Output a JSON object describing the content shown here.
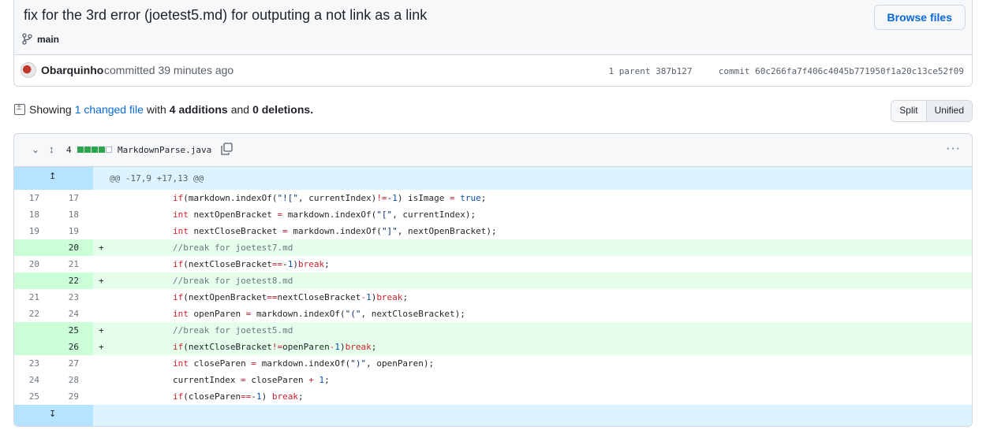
{
  "commit": {
    "title": "fix for the 3rd error (joetest5.md) for outputing a not link as a link",
    "browse_label": "Browse files",
    "branch": "main",
    "author": "Obarquinho",
    "committed_text": "committed 39 minutes ago",
    "parent_label": "1 parent",
    "parent_sha": "387b127",
    "commit_label": "commit",
    "commit_sha": "60c266fa7f406c4045b771950f1a20c13ce52f09"
  },
  "summary": {
    "showing": "Showing",
    "changed_link": "1 changed file",
    "with": "with",
    "additions": "4 additions",
    "and": "and",
    "deletions": "0 deletions.",
    "split_label": "Split",
    "unified_label": "Unified"
  },
  "file": {
    "change_count": "4",
    "name": "MarkdownParse.java",
    "diffstat": [
      "add",
      "add",
      "add",
      "add",
      "neutral"
    ]
  },
  "hunk": "@@ -17,9 +17,13 @@",
  "lines": [
    {
      "old": "17",
      "new": "17",
      "type": "ctx",
      "sign": "",
      "code": [
        [
          "kw",
          "if"
        ],
        [
          "t",
          "(markdown.indexOf("
        ],
        [
          "str",
          "\"![\""
        ],
        [
          "t",
          ", currentIndex)"
        ],
        [
          "kw",
          "!="
        ],
        [
          "t",
          "-"
        ],
        [
          "num",
          "1"
        ],
        [
          "t",
          ") isImage "
        ],
        [
          "kw",
          "="
        ],
        [
          "t",
          " "
        ],
        [
          "num",
          "true"
        ],
        [
          "t",
          ";"
        ]
      ]
    },
    {
      "old": "18",
      "new": "18",
      "type": "ctx",
      "sign": "",
      "code": [
        [
          "kw",
          "int"
        ],
        [
          "t",
          " nextOpenBracket "
        ],
        [
          "kw",
          "="
        ],
        [
          "t",
          " markdown.indexOf("
        ],
        [
          "str",
          "\"[\""
        ],
        [
          "t",
          ", currentIndex);"
        ]
      ]
    },
    {
      "old": "19",
      "new": "19",
      "type": "ctx",
      "sign": "",
      "code": [
        [
          "kw",
          "int"
        ],
        [
          "t",
          " nextCloseBracket "
        ],
        [
          "kw",
          "="
        ],
        [
          "t",
          " markdown.indexOf("
        ],
        [
          "str",
          "\"]\""
        ],
        [
          "t",
          ", nextOpenBracket);"
        ]
      ]
    },
    {
      "old": "",
      "new": "20",
      "type": "add",
      "sign": "+",
      "code": [
        [
          "cm",
          "//break for joetest7.md"
        ]
      ]
    },
    {
      "old": "20",
      "new": "21",
      "type": "ctx",
      "sign": "",
      "code": [
        [
          "kw",
          "if"
        ],
        [
          "t",
          "(nextCloseBracket"
        ],
        [
          "kw",
          "=="
        ],
        [
          "t",
          "-"
        ],
        [
          "num",
          "1"
        ],
        [
          "t",
          ")"
        ],
        [
          "kw",
          "break"
        ],
        [
          "t",
          ";"
        ]
      ]
    },
    {
      "old": "",
      "new": "22",
      "type": "add",
      "sign": "+",
      "code": [
        [
          "cm",
          "//break for joetest8.md"
        ]
      ]
    },
    {
      "old": "21",
      "new": "23",
      "type": "ctx",
      "sign": "",
      "code": [
        [
          "kw",
          "if"
        ],
        [
          "t",
          "(nextOpenBracket"
        ],
        [
          "kw",
          "=="
        ],
        [
          "t",
          "nextCloseBracket"
        ],
        [
          "kw",
          "-"
        ],
        [
          "num",
          "1"
        ],
        [
          "t",
          ")"
        ],
        [
          "kw",
          "break"
        ],
        [
          "t",
          ";"
        ]
      ]
    },
    {
      "old": "22",
      "new": "24",
      "type": "ctx",
      "sign": "",
      "code": [
        [
          "kw",
          "int"
        ],
        [
          "t",
          " openParen "
        ],
        [
          "kw",
          "="
        ],
        [
          "t",
          " markdown.indexOf("
        ],
        [
          "str",
          "\"(\""
        ],
        [
          "t",
          ", nextCloseBracket);"
        ]
      ]
    },
    {
      "old": "",
      "new": "25",
      "type": "add",
      "sign": "+",
      "code": [
        [
          "cm",
          "//break for joetest5.md"
        ]
      ]
    },
    {
      "old": "",
      "new": "26",
      "type": "add",
      "sign": "+",
      "code": [
        [
          "kw",
          "if"
        ],
        [
          "t",
          "(nextCloseBracket"
        ],
        [
          "kw",
          "!="
        ],
        [
          "t",
          "openParen"
        ],
        [
          "kw",
          "-"
        ],
        [
          "num",
          "1"
        ],
        [
          "t",
          ")"
        ],
        [
          "kw",
          "break"
        ],
        [
          "t",
          ";"
        ]
      ]
    },
    {
      "old": "23",
      "new": "27",
      "type": "ctx",
      "sign": "",
      "code": [
        [
          "kw",
          "int"
        ],
        [
          "t",
          " closeParen "
        ],
        [
          "kw",
          "="
        ],
        [
          "t",
          " markdown.indexOf("
        ],
        [
          "str",
          "\")\""
        ],
        [
          "t",
          ", openParen);"
        ]
      ]
    },
    {
      "old": "24",
      "new": "28",
      "type": "ctx",
      "sign": "",
      "code": [
        [
          "t",
          "currentIndex "
        ],
        [
          "kw",
          "="
        ],
        [
          "t",
          " closeParen "
        ],
        [
          "kw",
          "+"
        ],
        [
          "t",
          " "
        ],
        [
          "num",
          "1"
        ],
        [
          "t",
          ";"
        ]
      ]
    },
    {
      "old": "25",
      "new": "29",
      "type": "ctx",
      "sign": "",
      "code": [
        [
          "kw",
          "if"
        ],
        [
          "t",
          "(closeParen"
        ],
        [
          "kw",
          "=="
        ],
        [
          "t",
          "-"
        ],
        [
          "num",
          "1"
        ],
        [
          "t",
          ") "
        ],
        [
          "kw",
          "break"
        ],
        [
          "t",
          ";"
        ]
      ]
    }
  ],
  "colors": {
    "link": "#0969da",
    "added_bg": "#e6ffec",
    "added_gutter": "#ccffd8",
    "hunk_bg": "#ddf4ff",
    "diffstat_add": "#2da44e"
  }
}
